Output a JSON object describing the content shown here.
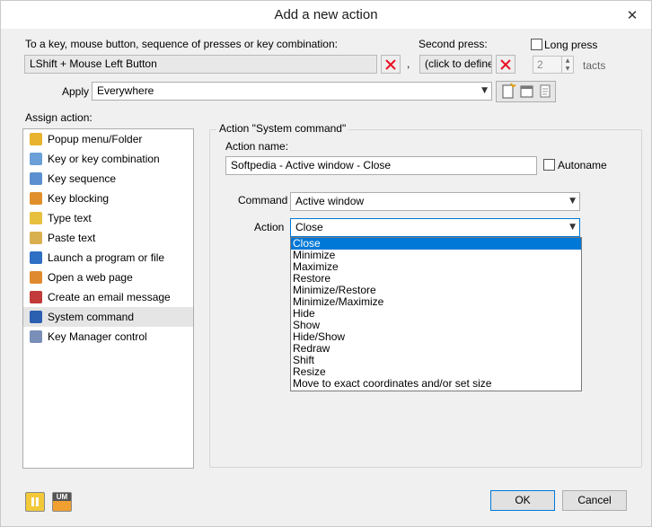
{
  "window": {
    "title": "Add a new action",
    "close_glyph": "✕"
  },
  "trigger": {
    "label": "To a key, mouse button, sequence of presses or key combination:",
    "value": "LShift + Mouse Left Button",
    "separator": ",",
    "second_press_label": "Second press:",
    "second_press_value": "(click to define)",
    "long_press_label": "Long press",
    "long_press_checked": false,
    "tacts_value": "2",
    "tacts_label": "tacts"
  },
  "apply": {
    "label": "Apply",
    "value": "Everywhere"
  },
  "assign": {
    "label": "Assign action:",
    "items": [
      {
        "label": "Popup menu/Folder",
        "icon": "folder-icon",
        "color": "#e8b32e"
      },
      {
        "label": "Key or key combination",
        "icon": "key-icon",
        "color": "#6a9fd8"
      },
      {
        "label": "Key sequence",
        "icon": "key-sequence-icon",
        "color": "#5b8fd0"
      },
      {
        "label": "Key blocking",
        "icon": "key-block-icon",
        "color": "#e0902a"
      },
      {
        "label": "Type text",
        "icon": "type-text-icon",
        "color": "#e8c040"
      },
      {
        "label": "Paste text",
        "icon": "paste-text-icon",
        "color": "#d9b050"
      },
      {
        "label": "Launch a program or file",
        "icon": "launch-program-icon",
        "color": "#2f6fc4"
      },
      {
        "label": "Open a web page",
        "icon": "globe-icon",
        "color": "#e08a30"
      },
      {
        "label": "Create an email message",
        "icon": "email-icon",
        "color": "#c23a3a"
      },
      {
        "label": "System command",
        "icon": "system-command-icon",
        "color": "#2b5fb0"
      },
      {
        "label": "Key Manager control",
        "icon": "key-manager-icon",
        "color": "#7a8fb8"
      }
    ],
    "selected_index": 9
  },
  "action_panel": {
    "group_title": "Action \"System command\"",
    "name_label": "Action name:",
    "name_value": "Softpedia - Active window - Close",
    "autoname_label": "Autoname",
    "autoname_checked": false,
    "command_label": "Command",
    "command_value": "Active window",
    "action_label": "Action",
    "action_value": "Close",
    "action_options": [
      "Close",
      "Minimize",
      "Maximize",
      "Restore",
      "Minimize/Restore",
      "Minimize/Maximize",
      "Hide",
      "Show",
      "Hide/Show",
      "Redraw",
      "Shift",
      "Resize",
      "Move to exact coordinates and/or set size"
    ],
    "highlighted_option_index": 0
  },
  "buttons": {
    "ok": "OK",
    "cancel": "Cancel"
  },
  "bottom_icons": {
    "left": "pause-icon",
    "right": "key-manager-logo-icon",
    "logo_text": "UM"
  },
  "colors": {
    "highlight": "#0078d7",
    "clear_x": "#e81123"
  }
}
